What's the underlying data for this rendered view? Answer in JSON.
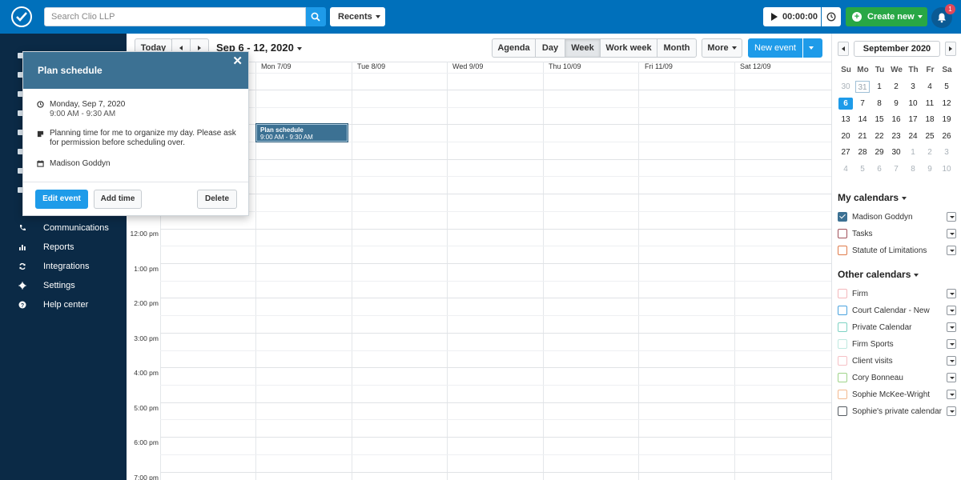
{
  "topbar": {
    "search_placeholder": "Search Clio LLP",
    "recents_label": "Recents",
    "timer_value": "00:00:00",
    "create_label": "Create new",
    "notification_count": "1"
  },
  "sidebar": {
    "items": [
      {
        "label": "Communications",
        "icon": "phone-icon"
      },
      {
        "label": "Reports",
        "icon": "bar-chart-icon"
      },
      {
        "label": "Integrations",
        "icon": "sync-icon"
      },
      {
        "label": "Settings",
        "icon": "gear-icon"
      },
      {
        "label": "Help center",
        "icon": "question-icon"
      }
    ]
  },
  "toolbar": {
    "today_label": "Today",
    "date_range": "Sep 6 - 12, 2020",
    "views": [
      "Agenda",
      "Day",
      "Week",
      "Work week",
      "Month"
    ],
    "active_view": "Week",
    "more_label": "More",
    "new_event_label": "New event"
  },
  "days": [
    "Mon 7/09",
    "Tue 8/09",
    "Wed 9/09",
    "Thu 10/09",
    "Fri 11/09",
    "Sat 12/09"
  ],
  "times": [
    "12:00 pm",
    "1:00 pm",
    "2:00 pm",
    "3:00 pm",
    "4:00 pm",
    "5:00 pm",
    "6:00 pm",
    "7:00 pm"
  ],
  "event": {
    "title": "Plan schedule",
    "time": "9:00 AM - 9:30 AM"
  },
  "popover": {
    "title": "Plan schedule",
    "date": "Monday, Sep 7, 2020",
    "time": "9:00 AM - 9:30 AM",
    "description": "Planning time for me to organize my day. Please ask for permission before scheduling over.",
    "owner": "Madison Goddyn",
    "edit_label": "Edit event",
    "add_time_label": "Add time",
    "delete_label": "Delete"
  },
  "mini_calendar": {
    "month_label": "September 2020",
    "weekdays": [
      "Su",
      "Mo",
      "Tu",
      "We",
      "Th",
      "Fr",
      "Sa"
    ],
    "weeks": [
      [
        "30",
        "31",
        "1",
        "2",
        "3",
        "4",
        "5"
      ],
      [
        "6",
        "7",
        "8",
        "9",
        "10",
        "11",
        "12"
      ],
      [
        "13",
        "14",
        "15",
        "16",
        "17",
        "18",
        "19"
      ],
      [
        "20",
        "21",
        "22",
        "23",
        "24",
        "25",
        "26"
      ],
      [
        "27",
        "28",
        "29",
        "30",
        "1",
        "2",
        "3"
      ],
      [
        "4",
        "5",
        "6",
        "7",
        "8",
        "9",
        "10"
      ]
    ],
    "selected_day": "6"
  },
  "my_calendars": {
    "heading": "My calendars",
    "items": [
      {
        "label": "Madison Goddyn",
        "color": "#3c7193",
        "checked": true
      },
      {
        "label": "Tasks",
        "color": "#a0505a",
        "checked": false
      },
      {
        "label": "Statute of Limitations",
        "color": "#e07b4a",
        "checked": false
      }
    ]
  },
  "other_calendars": {
    "heading": "Other calendars",
    "items": [
      {
        "label": "Firm",
        "color": "#f4b8bc"
      },
      {
        "label": "Court Calendar - New",
        "color": "#4aa3df"
      },
      {
        "label": "Private Calendar",
        "color": "#7fd3c4"
      },
      {
        "label": "Firm Sports",
        "color": "#bfe9e0"
      },
      {
        "label": "Client visits",
        "color": "#f6c1c6"
      },
      {
        "label": "Cory Bonneau",
        "color": "#9fd48a"
      },
      {
        "label": "Sophie McKee-Wright",
        "color": "#f3b98f"
      },
      {
        "label": "Sophie's private calendar",
        "color": "#555b61"
      }
    ]
  },
  "colors": {
    "brand_blue": "#0070bb",
    "sidebar_bg": "#0b2a46",
    "event_bg": "#3c7193",
    "create_green": "#28a745",
    "accent_blue": "#1e9be9"
  }
}
